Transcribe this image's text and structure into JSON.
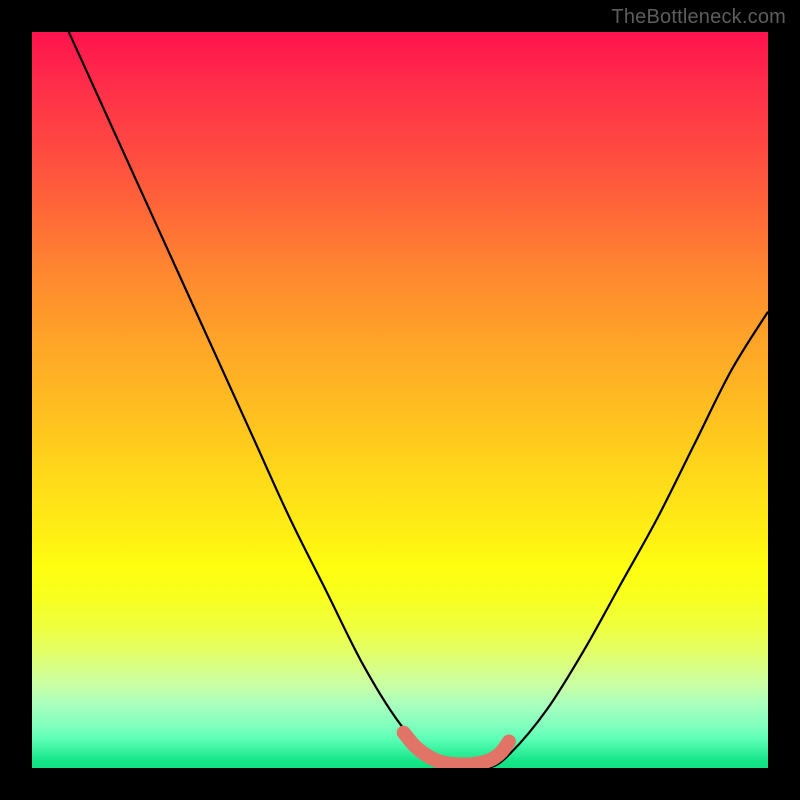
{
  "attribution": "TheBottleneck.com",
  "colors": {
    "background": "#000000",
    "curve": "#000000",
    "highlight": "#e17367"
  },
  "chart_data": {
    "type": "line",
    "title": "",
    "xlabel": "",
    "ylabel": "",
    "xlim": [
      0,
      100
    ],
    "ylim": [
      0,
      100
    ],
    "series": [
      {
        "name": "bottleneck-curve",
        "x": [
          5,
          10,
          15,
          20,
          25,
          30,
          35,
          40,
          45,
          50,
          54,
          58,
          62,
          65,
          70,
          75,
          80,
          85,
          90,
          95,
          100
        ],
        "y": [
          100,
          89,
          78,
          67,
          56,
          45,
          34,
          24,
          14,
          6,
          2,
          0,
          0,
          2,
          8,
          16,
          25,
          34,
          44,
          54,
          62
        ]
      }
    ],
    "highlight": {
      "name": "optimal-zone",
      "x": [
        50.5,
        52,
        53.5,
        55,
        56.5,
        58,
        59.5,
        61,
        62.5,
        63.8,
        64.8
      ],
      "y": [
        4.8,
        3.0,
        1.8,
        1.0,
        0.6,
        0.5,
        0.5,
        0.7,
        1.2,
        2.2,
        3.6
      ]
    }
  }
}
